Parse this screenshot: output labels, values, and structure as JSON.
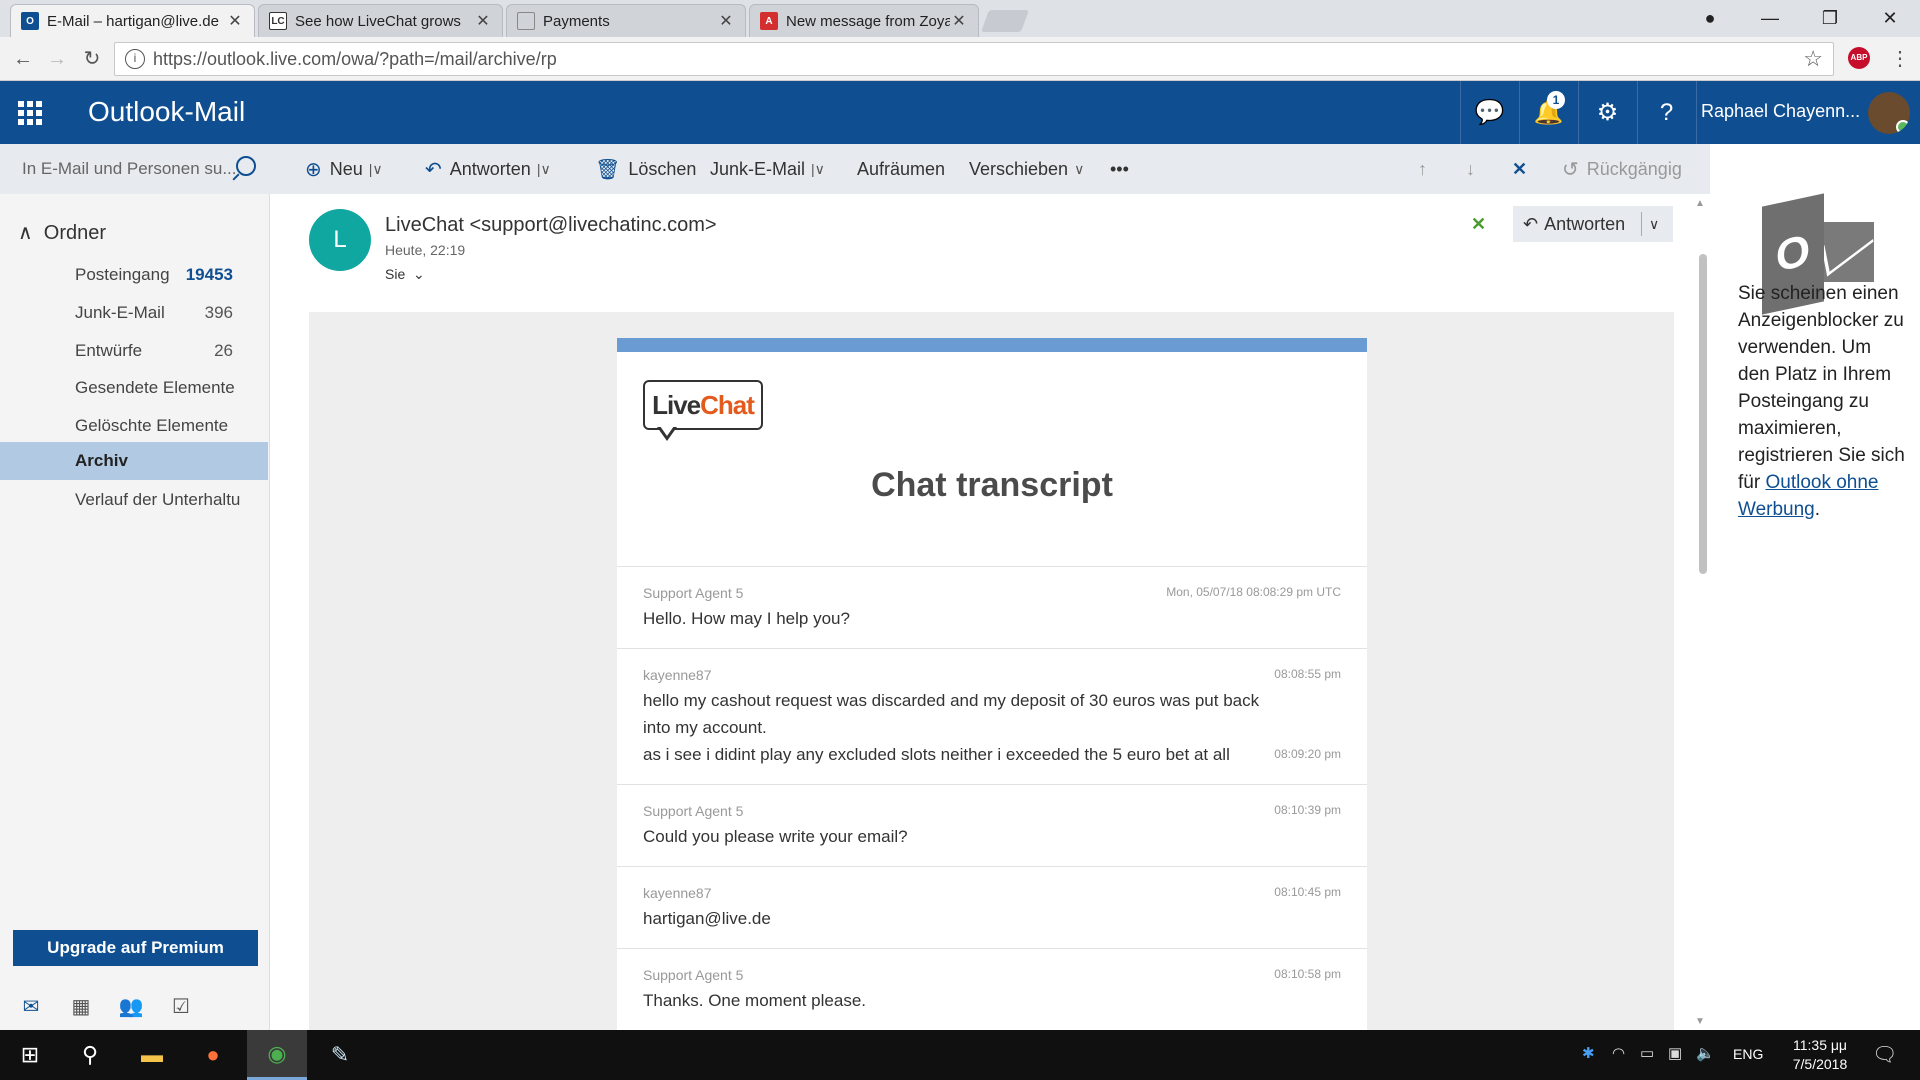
{
  "browser": {
    "tabs": [
      {
        "title": "E-Mail – hartigan@live.de",
        "icon": "outlook-icon",
        "color": "#0f4f91"
      },
      {
        "title": "See how LiveChat grows",
        "icon": "livechat-icon",
        "color": "#333333"
      },
      {
        "title": "Payments",
        "icon": "page-icon",
        "color": "#888888"
      },
      {
        "title": "New message from Zoya",
        "icon": "pdf-icon",
        "color": "#d32f2f"
      }
    ],
    "url": "https://outlook.live.com/owa/?path=/mail/archive/rp"
  },
  "outlook": {
    "app_title": "Outlook-Mail",
    "notification_count": "1",
    "user_name": "Raphael Chayenn...",
    "accent": "#0f4f91"
  },
  "search": {
    "placeholder": "In E-Mail und Personen su..."
  },
  "commands": {
    "new": "Neu",
    "reply": "Antworten",
    "delete": "Löschen",
    "junk": "Junk-E-Mail",
    "sweep": "Aufräumen",
    "move": "Verschieben",
    "more": "•••",
    "undo": "Rückgängig"
  },
  "nav": {
    "folders_heading": "Ordner",
    "folders": [
      {
        "label": "Posteingang",
        "count": "19453"
      },
      {
        "label": "Junk-E-Mail",
        "count": "396"
      },
      {
        "label": "Entwürfe",
        "count": "26"
      },
      {
        "label": "Gesendete Elemente",
        "count": ""
      },
      {
        "label": "Gelöschte Elemente",
        "count": ""
      },
      {
        "label": "Archiv",
        "count": ""
      },
      {
        "label": "Verlauf der Unterhaltu",
        "count": ""
      }
    ],
    "premium": "Upgrade auf Premium"
  },
  "email": {
    "avatar_letter": "L",
    "sender": "LiveChat <support@livechatinc.com>",
    "time": "Heute, 22:19",
    "to": "Sie",
    "reply_label": "Antworten",
    "logo_live": "Live",
    "logo_chat": "Chat",
    "title": "Chat transcript",
    "messages": [
      {
        "author": "Support Agent 5",
        "time": "Mon, 05/07/18 08:08:29 pm UTC",
        "lines": [
          "Hello. How may I help you?"
        ]
      },
      {
        "author": "kayenne87",
        "time": "08:08:55 pm",
        "lines": [
          "hello my cashout request was discarded and my deposit of 30 euros was put back into my account.",
          "as i see i didint play any excluded slots neither i exceeded the 5 euro bet at all"
        ],
        "time2": "08:09:20 pm"
      },
      {
        "author": "Support Agent 5",
        "time": "08:10:39 pm",
        "lines": [
          "Could you please write your email?"
        ]
      },
      {
        "author": "kayenne87",
        "time": "08:10:45 pm",
        "lines": [
          "hartigan@live.de"
        ]
      },
      {
        "author": "Support Agent 5",
        "time": "08:10:58 pm",
        "lines": [
          "Thanks. One moment please."
        ]
      }
    ]
  },
  "ad": {
    "text": "Sie scheinen einen Anzeigenblocker zu verwenden. Um den Platz in Ihrem Posteingang zu maximieren, registrieren Sie sich für",
    "link": "Outlook ohne Werbung",
    "tail": "."
  },
  "taskbar": {
    "lang": "ENG",
    "time": "11:35 μμ",
    "date": "7/5/2018"
  }
}
